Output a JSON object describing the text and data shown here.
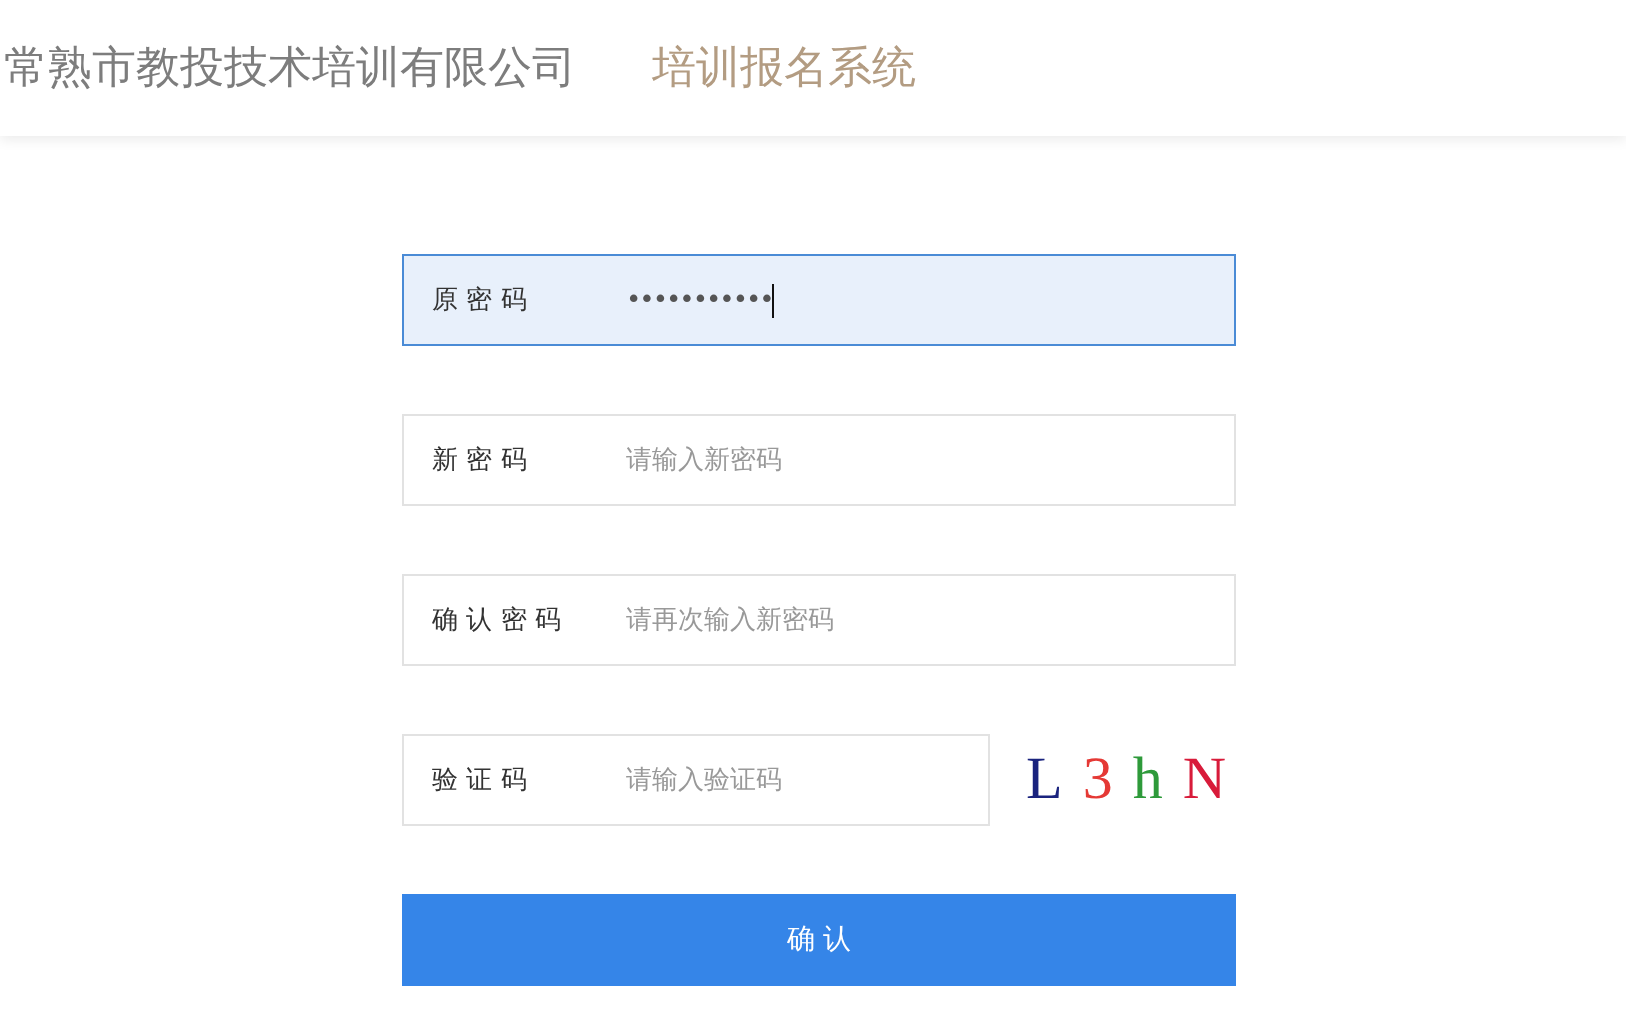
{
  "header": {
    "company": "常熟市教投技术培训有限公司",
    "system": "培训报名系统"
  },
  "fields": [
    {
      "kind": "password",
      "label": "原 密 码",
      "value": "•••••••••••",
      "focused": true
    },
    {
      "kind": "password",
      "label": "新 密 码",
      "placeholder": "请输入新密码",
      "focused": false
    },
    {
      "kind": "password",
      "label": "确 认 密 码",
      "placeholder": "请再次输入新密码",
      "focused": false
    },
    {
      "kind": "captcha",
      "label": "验 证 码",
      "placeholder": "请输入验证码",
      "focused": false,
      "captcha": [
        {
          "char": "L",
          "color": "#1a237e"
        },
        {
          "char": "3",
          "color": "#e53935"
        },
        {
          "char": "h",
          "color": "#2e9a3a"
        },
        {
          "char": "N",
          "color": "#d81b3a"
        }
      ]
    }
  ],
  "submit": "确 认"
}
